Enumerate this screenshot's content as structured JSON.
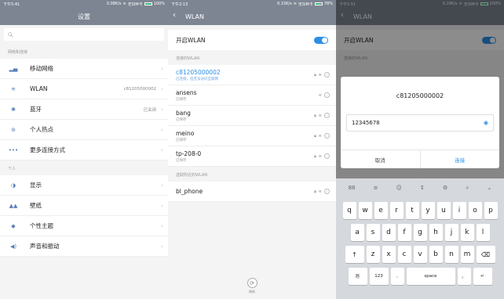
{
  "screen1": {
    "status_time": "下午5:41",
    "status_right": "0.08K/s",
    "status_carrier": "无SIM卡",
    "status_battery": "100%",
    "title": "设置",
    "search_placeholder": "",
    "section_network": "网络和连接",
    "items_network": [
      {
        "icon": "signal-icon",
        "glyph": "▂▄",
        "label": "移动网络",
        "value": ""
      },
      {
        "icon": "wifi-icon",
        "glyph": "≋",
        "label": "WLAN",
        "value": "c81205000002"
      },
      {
        "icon": "bluetooth-icon",
        "glyph": "✱",
        "label": "蓝牙",
        "value": "已关闭"
      },
      {
        "icon": "hotspot-icon",
        "glyph": "⊚",
        "label": "个人热点",
        "value": ""
      },
      {
        "icon": "more-icon",
        "glyph": "•••",
        "label": "更多连接方式",
        "value": ""
      }
    ],
    "section_personal": "个人",
    "items_personal": [
      {
        "icon": "display-icon",
        "glyph": "◑",
        "label": "显示",
        "value": ""
      },
      {
        "icon": "wallpaper-icon",
        "glyph": "▲▲",
        "label": "壁纸",
        "value": ""
      },
      {
        "icon": "theme-icon",
        "glyph": "◆",
        "label": "个性主题",
        "value": ""
      },
      {
        "icon": "sound-icon",
        "glyph": "◀)",
        "label": "声音和振动",
        "value": ""
      }
    ]
  },
  "screen2": {
    "status_time": "下午2:13",
    "status_right": "0.15K/s",
    "status_carrier": "无SIM卡",
    "status_battery": "78%",
    "title": "WLAN",
    "toggle_label": "开启WLAN",
    "section_connected": "连接的WLAN",
    "saved_networks": [
      {
        "name": "c81205000002",
        "status": "已连接，但无法访问互联网",
        "active": true,
        "lock": true
      },
      {
        "name": "ansens",
        "status": "已保存",
        "active": false,
        "lock": false
      },
      {
        "name": "bang",
        "status": "已保存",
        "active": false,
        "lock": true
      },
      {
        "name": "meino",
        "status": "已保存",
        "active": false,
        "lock": true
      },
      {
        "name": "tp-208-0",
        "status": "已保存",
        "active": false,
        "lock": true
      }
    ],
    "section_nearby": "选取附近的WLAN",
    "nearby_networks": [
      {
        "name": "bl_phone",
        "status": "",
        "active": false,
        "lock": true
      }
    ],
    "refresh_label": "刷新"
  },
  "screen3": {
    "status_time": "下午5:51",
    "status_right": "6.29K/s",
    "status_carrier": "无SIM卡",
    "status_battery": "100%",
    "title": "WLAN",
    "toggle_label": "开启WLAN",
    "section_connected": "连接的WLAN",
    "dialog": {
      "ssid": "c81205000002",
      "password": "12345678",
      "cancel": "取消",
      "connect": "连接"
    },
    "keyboard": {
      "toolbar": [
        "88",
        "≡",
        "☺",
        "↕",
        "⚙",
        "⌕",
        "⌄"
      ],
      "row1": [
        "q",
        "w",
        "e",
        "r",
        "t",
        "y",
        "u",
        "i",
        "o",
        "p"
      ],
      "row2": [
        "a",
        "s",
        "d",
        "f",
        "g",
        "h",
        "j",
        "k",
        "l"
      ],
      "row3": [
        "z",
        "x",
        "c",
        "v",
        "b",
        "n",
        "m"
      ],
      "shift": "↑",
      "backspace": "⌫",
      "sym": "符",
      "num": "123",
      "comma": ",",
      "space": "space",
      "period": "。",
      "enter": "↵"
    }
  },
  "colors": {
    "accent": "#2c8fe8",
    "header_grey": "#7d8593"
  }
}
